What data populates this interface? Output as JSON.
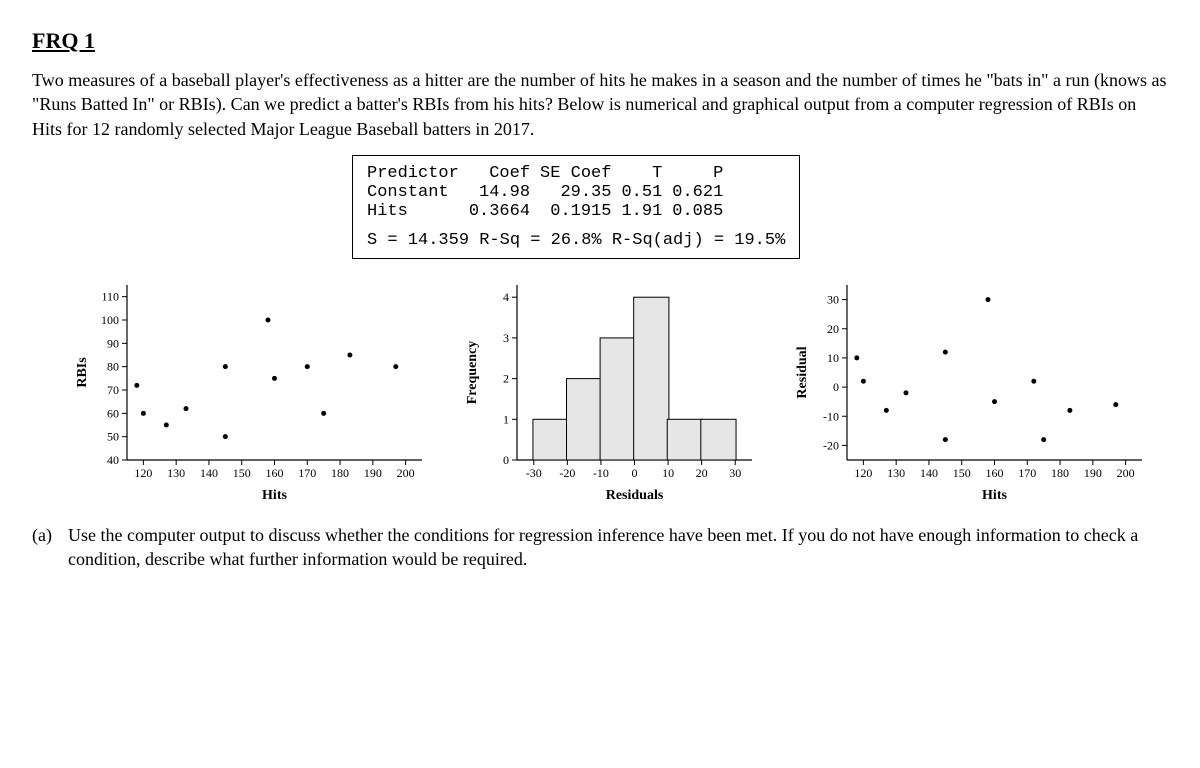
{
  "title": "FRQ 1",
  "intro": "Two measures of a baseball player's effectiveness as a hitter are the number of hits he makes in a season and the number of times he \"bats in\" a run (knows as \"Runs Batted In\" or RBIs).  Can we predict a batter's RBIs from his hits?  Below is numerical and graphical output from a computer regression of RBIs on Hits for 12 randomly selected Major League Baseball batters in 2017.",
  "regression": {
    "headers": [
      "Predictor",
      "Coef",
      "SE Coef",
      "T",
      "P"
    ],
    "rows": [
      {
        "predictor": "Constant",
        "coef": "14.98",
        "se": "29.35",
        "t": "0.51",
        "p": "0.621"
      },
      {
        "predictor": "Hits",
        "coef": "0.3664",
        "se": "0.1915",
        "t": "1.91",
        "p": "0.085"
      }
    ],
    "stats": "S = 14.359 R-Sq = 26.8% R-Sq(adj) = 19.5%"
  },
  "question_a": {
    "marker": "(a)",
    "text": "Use the computer output to discuss whether the conditions for regression inference have been met.  If you do not have enough information to check a condition, describe what further information would be required."
  },
  "chart_data": [
    {
      "type": "scatter",
      "title": "",
      "xlabel": "Hits",
      "ylabel": "RBIs",
      "xlim": [
        115,
        205
      ],
      "ylim": [
        40,
        115
      ],
      "xticks": [
        120,
        130,
        140,
        150,
        160,
        170,
        180,
        190,
        200
      ],
      "yticks": [
        40,
        50,
        60,
        70,
        80,
        90,
        100,
        110
      ],
      "points": [
        {
          "x": 118,
          "y": 72
        },
        {
          "x": 120,
          "y": 60
        },
        {
          "x": 127,
          "y": 55
        },
        {
          "x": 133,
          "y": 62
        },
        {
          "x": 145,
          "y": 50
        },
        {
          "x": 145,
          "y": 80
        },
        {
          "x": 158,
          "y": 100
        },
        {
          "x": 160,
          "y": 75
        },
        {
          "x": 170,
          "y": 80
        },
        {
          "x": 175,
          "y": 60
        },
        {
          "x": 183,
          "y": 85
        },
        {
          "x": 197,
          "y": 80
        }
      ]
    },
    {
      "type": "bar",
      "title": "",
      "xlabel": "Residuals",
      "ylabel": "Frequency",
      "xlim": [
        -35,
        35
      ],
      "ylim": [
        0,
        4.3
      ],
      "xticks": [
        -30,
        -20,
        -10,
        0,
        10,
        20,
        30
      ],
      "yticks": [
        0,
        1,
        2,
        3,
        4
      ],
      "categories": [
        -25,
        -15,
        -5,
        5,
        15,
        25
      ],
      "values": [
        1,
        2,
        3,
        4,
        1,
        1
      ]
    },
    {
      "type": "scatter",
      "title": "",
      "xlabel": "Hits",
      "ylabel": "Residual",
      "xlim": [
        115,
        205
      ],
      "ylim": [
        -25,
        35
      ],
      "xticks": [
        120,
        130,
        140,
        150,
        160,
        170,
        180,
        190,
        200
      ],
      "yticks": [
        -20,
        -10,
        0,
        10,
        20,
        30
      ],
      "points": [
        {
          "x": 118,
          "y": 10
        },
        {
          "x": 120,
          "y": 2
        },
        {
          "x": 127,
          "y": -8
        },
        {
          "x": 133,
          "y": -2
        },
        {
          "x": 145,
          "y": -18
        },
        {
          "x": 145,
          "y": 12
        },
        {
          "x": 158,
          "y": 30
        },
        {
          "x": 160,
          "y": -5
        },
        {
          "x": 172,
          "y": 2
        },
        {
          "x": 175,
          "y": -18
        },
        {
          "x": 183,
          "y": -8
        },
        {
          "x": 197,
          "y": -6
        }
      ]
    }
  ]
}
